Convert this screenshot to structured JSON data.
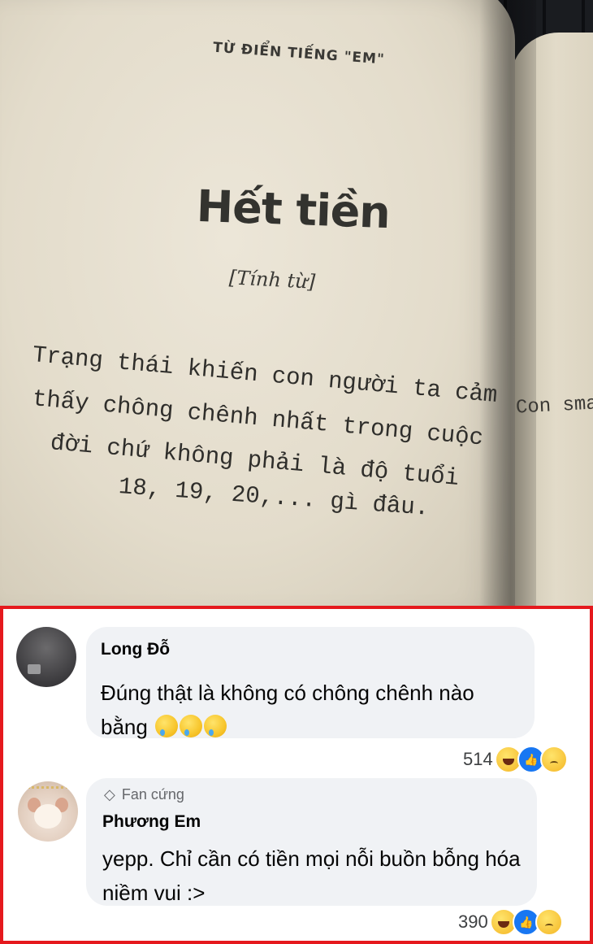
{
  "photo": {
    "header": "TỪ ĐIỂN TIẾNG \"EM\"",
    "title": "Hết tiền",
    "part_of_speech": "[Tính từ]",
    "definition_lines": [
      "Trạng thái khiến con người ta cảm",
      "thấy chông chênh nhất trong cuộc",
      "đời chứ không phải là độ tuổi",
      "18, 19, 20,...  gì đâu."
    ],
    "right_page_text": "Con sma"
  },
  "comments": [
    {
      "author": "Long Đỗ",
      "text": "Đúng thật là không có chông chênh nào bằng",
      "emojis": [
        "crying-face",
        "crying-face",
        "crying-face"
      ],
      "reaction_count": "514",
      "reactions": [
        "haha",
        "like",
        "sad"
      ]
    },
    {
      "badge": "Fan cứng",
      "author": "Phương Em",
      "text": "yepp. Chỉ cần có tiền mọi nỗi buồn bỗng hóa niềm vui :>",
      "reaction_count": "390",
      "reactions": [
        "haha",
        "like",
        "sad"
      ]
    }
  ],
  "colors": {
    "highlight_border": "#e5191d",
    "bubble": "#f0f2f5",
    "like_blue": "#1877f2"
  }
}
